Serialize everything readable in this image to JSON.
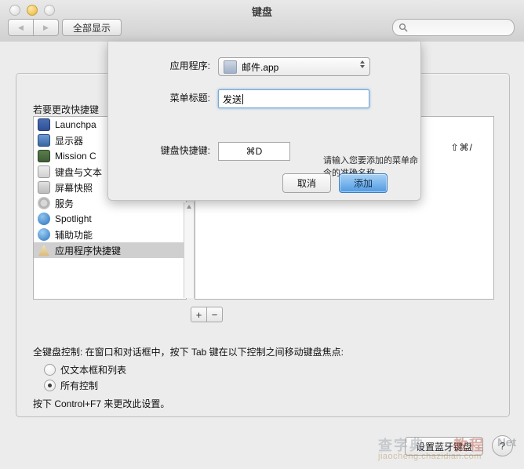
{
  "window": {
    "title": "键盘",
    "show_all_label": "全部显示",
    "search_placeholder": "",
    "nav_back_icon": "triangle-left-icon",
    "nav_forward_icon": "triangle-right-icon"
  },
  "main": {
    "hint": "若要更改快捷键",
    "left_list": [
      {
        "label": "Launchpa",
        "icon": "launchpad-icon",
        "selected": false
      },
      {
        "label": "显示器",
        "icon": "display-icon",
        "selected": false
      },
      {
        "label": "Mission C",
        "icon": "mission-control-icon",
        "selected": false
      },
      {
        "label": "键盘与文本",
        "icon": "keyboard-icon",
        "selected": false
      },
      {
        "label": "屏幕快照",
        "icon": "screenshot-icon",
        "selected": false
      },
      {
        "label": "服务",
        "icon": "services-gear-icon",
        "selected": false
      },
      {
        "label": "Spotlight",
        "icon": "spotlight-icon",
        "selected": false
      },
      {
        "label": "辅助功能",
        "icon": "accessibility-icon",
        "selected": false
      },
      {
        "label": "应用程序快捷键",
        "icon": "app-shortcuts-icon",
        "selected": true
      }
    ],
    "right_list": {
      "shortcut": "⇧⌘/"
    },
    "add_button_label": "+",
    "remove_button_label": "−",
    "full_keyboard_access_text": "全键盘控制: 在窗口和对话框中，按下 Tab 键在以下控制之间移动键盘焦点:",
    "radios": [
      {
        "label": "仅文本框和列表",
        "selected": false
      },
      {
        "label": "所有控制",
        "selected": true
      }
    ],
    "control_note": "按下 Control+F7 来更改此设置。"
  },
  "bottom": {
    "bluetooth_button": "设置蓝牙键盘",
    "help_button": "?"
  },
  "sheet": {
    "application_label": "应用程序:",
    "application_value": "邮件.app",
    "application_icon": "mail-app-icon",
    "menu_title_label": "菜单标题:",
    "menu_title_value": "发送",
    "menu_title_hint": "请输入您要添加的菜单命令的准确名称。",
    "shortcut_label": "键盘快捷键:",
    "shortcut_value": "⌘D",
    "cancel_label": "取消",
    "add_label": "添加"
  },
  "watermark": {
    "cn": "查字典",
    "cn2": "教程",
    "net": "Net",
    "url": "jiaocheng.chazidian.com"
  }
}
